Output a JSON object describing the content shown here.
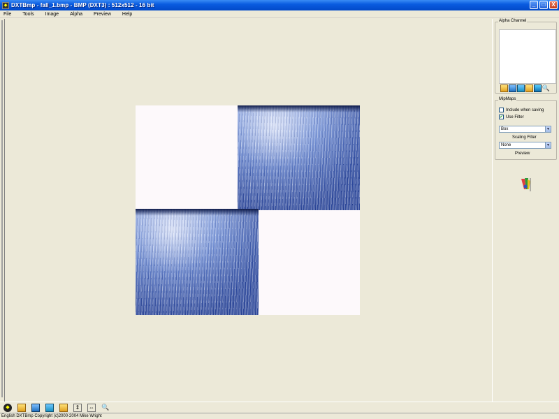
{
  "window": {
    "title": "DXTBmp - fall_1.bmp - BMP (DXT3) : 512x512 - 16 bit",
    "minimize": "_",
    "maximize": "□",
    "close": "X"
  },
  "menu": [
    "File",
    "Tools",
    "Image",
    "Alpha",
    "Preview",
    "Help"
  ],
  "right_panel": {
    "alpha_channel": {
      "label": "Alpha Channel",
      "tool_icons": [
        "folder-icon",
        "save-icon",
        "image-icon",
        "open-folder-icon",
        "monitor-icon",
        "magnifier-icon"
      ]
    },
    "mipmaps": {
      "label": "MipMaps",
      "include_when_saving": {
        "label": "Include when saving",
        "checked": false
      },
      "use_filter": {
        "label": "Use Filter",
        "checked": true,
        "check_glyph": "✔"
      },
      "size_select": {
        "value": "Box"
      },
      "scaling_filter_label": "Scaling Filter",
      "filter_select": {
        "value": "None"
      },
      "link_label": "Preview"
    }
  },
  "bottom_toolbar": [
    "logo-icon",
    "open-folder-icon",
    "save-icon",
    "image-icon",
    "folder-icon",
    "swap-vertical-icon",
    "swap-horizontal-icon",
    "magnifier-icon"
  ],
  "status": "English  DXTBmp Copyright (c)2000-2004 Mike Wright",
  "colors": {
    "titlebar": "#0a5ce0",
    "workspace": "#ece9d8",
    "white_tile": "#fdf9fb",
    "forest_blue": "#2f4fa6"
  }
}
